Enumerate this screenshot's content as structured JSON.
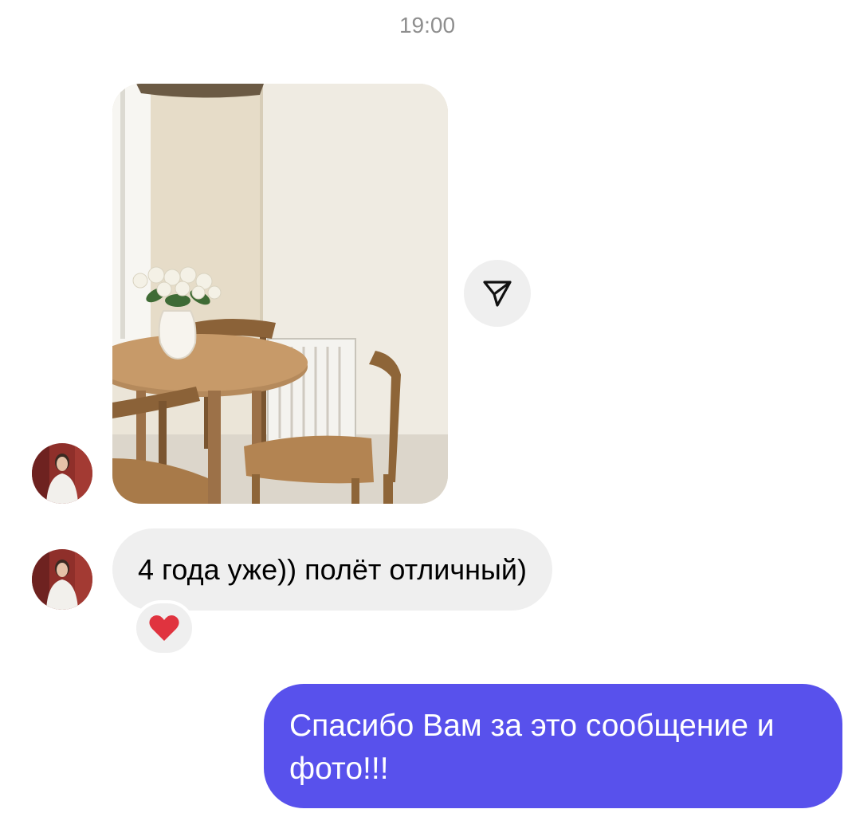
{
  "chat": {
    "timestamp": "19:00",
    "messages": [
      {
        "from": "contact",
        "type": "photo",
        "description_icon": "dining-room-photo"
      },
      {
        "from": "contact",
        "type": "text",
        "text": "4 года уже)) полёт отличный)",
        "reaction": "❤️"
      },
      {
        "from": "me",
        "type": "text",
        "text": "Спасибо Вам за это сообщение и фото!!!"
      }
    ]
  },
  "colors": {
    "outgoing_bubble": "#5851ec",
    "incoming_bubble": "#efefef",
    "timestamp": "#8e8e8e",
    "reaction_heart": "#e0333f"
  },
  "icons": {
    "share": "paper-plane-icon",
    "reaction": "heart-icon"
  }
}
